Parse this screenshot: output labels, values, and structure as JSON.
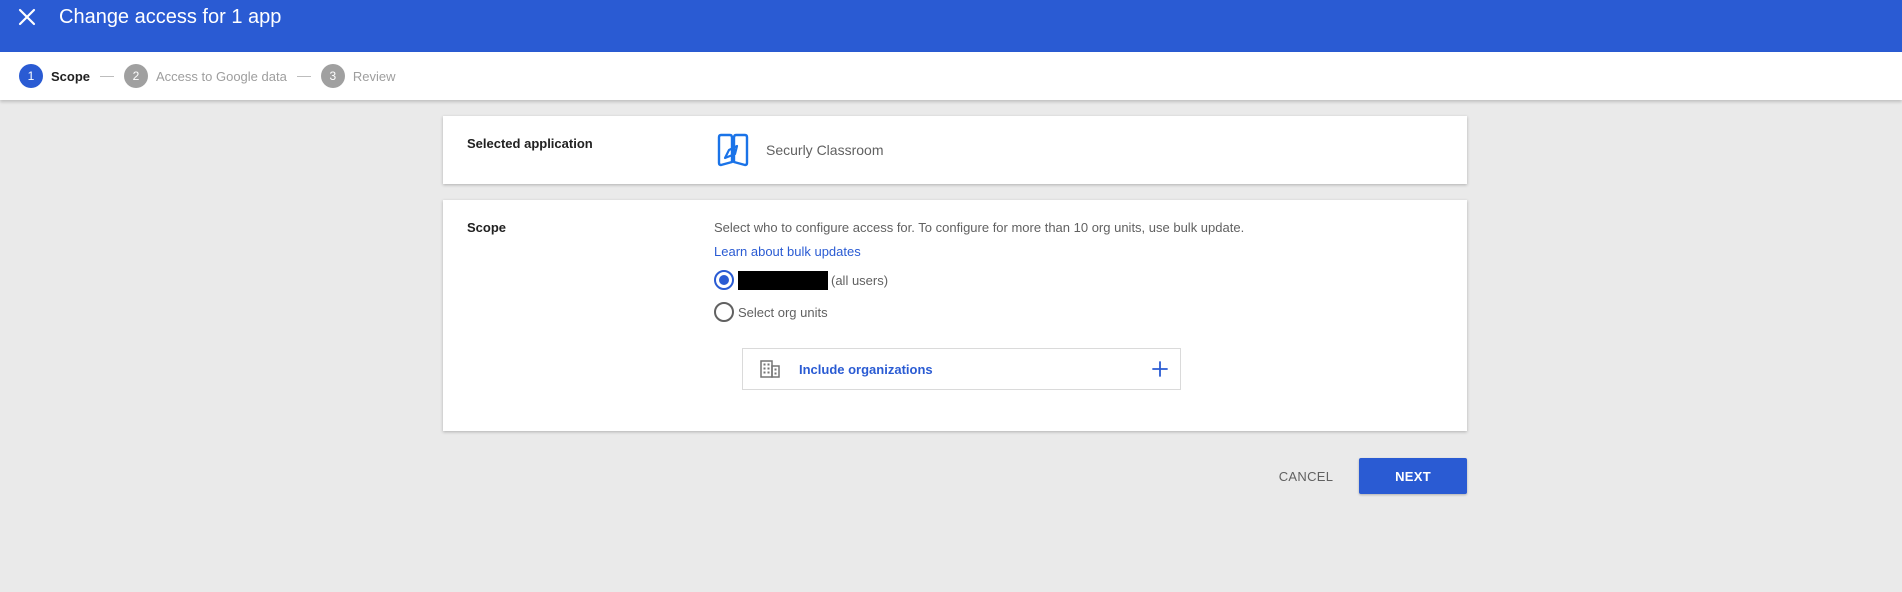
{
  "header": {
    "title": "Change access for 1 app",
    "close_icon": "close-icon",
    "color": "#2a5bd3"
  },
  "stepper": {
    "steps": [
      {
        "number": "1",
        "label": "Scope",
        "state": "active"
      },
      {
        "number": "2",
        "label": "Access to Google data",
        "state": "inactive"
      },
      {
        "number": "3",
        "label": "Review",
        "state": "inactive"
      }
    ]
  },
  "selected_app": {
    "label": "Selected application",
    "app_name": "Securly Classroom",
    "app_icon": "securly-logo-icon"
  },
  "scope": {
    "label": "Scope",
    "description": "Select who to configure access for. To configure for more than 10 org units, use bulk update.",
    "link": "Learn about bulk updates",
    "options": [
      {
        "suffix": "(all users)",
        "redacted": true,
        "checked": true
      },
      {
        "label": "Select org units",
        "checked": false
      }
    ],
    "include": {
      "label": "Include organizations",
      "icon": "building-icon",
      "add_icon": "plus-icon"
    }
  },
  "actions": {
    "cancel": "CANCEL",
    "next": "NEXT"
  }
}
